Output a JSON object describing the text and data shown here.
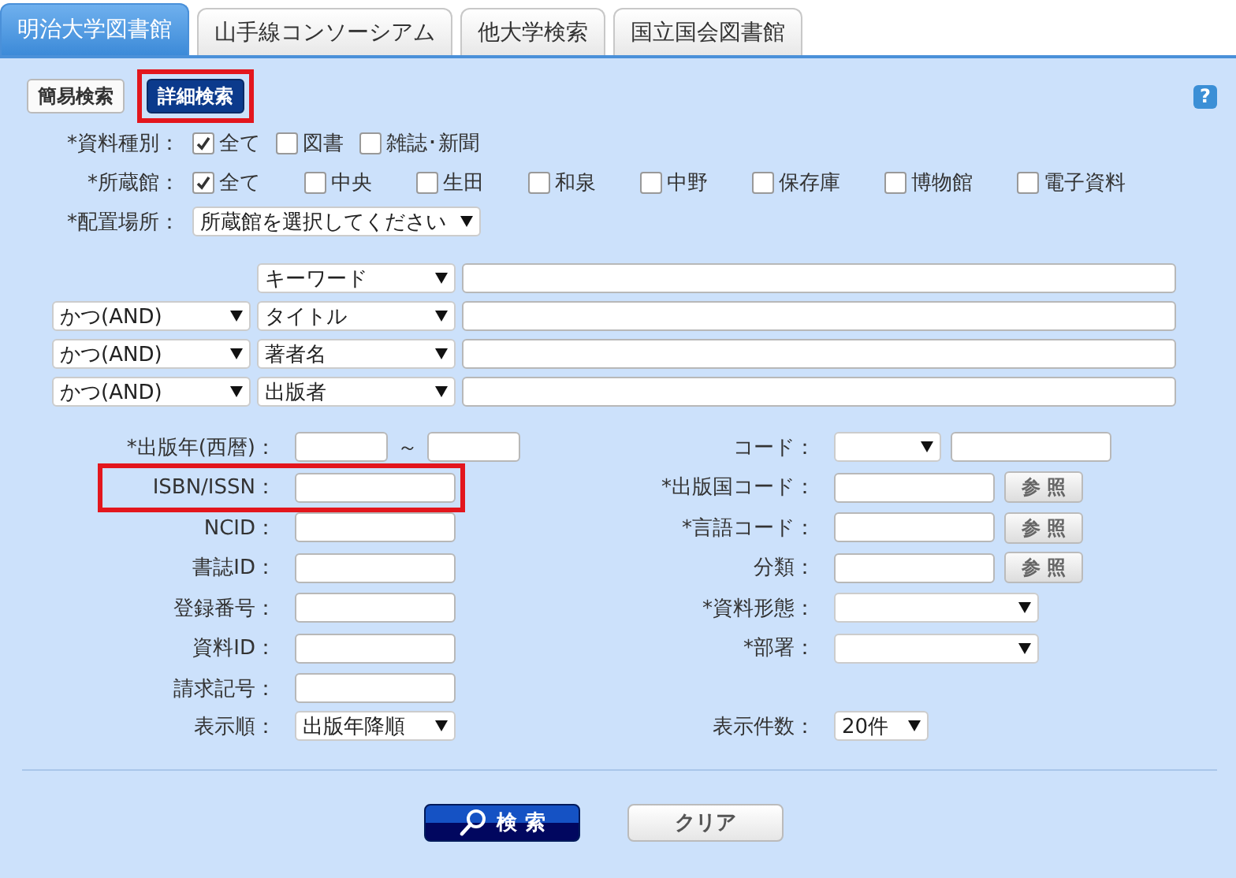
{
  "tabs": [
    {
      "label": "明治大学図書館",
      "selected": true
    },
    {
      "label": "山手線コンソーシアム",
      "selected": false
    },
    {
      "label": "他大学検索",
      "selected": false
    },
    {
      "label": "国立国会図書館",
      "selected": false
    }
  ],
  "mode_buttons": [
    {
      "label": "簡易検索",
      "selected": false,
      "highlighted": false
    },
    {
      "label": "詳細検索",
      "selected": true,
      "highlighted": true
    }
  ],
  "help": {
    "label": "?"
  },
  "filters": [
    {
      "label": "*資料種別：",
      "kind": "compact",
      "options": [
        {
          "label": "全て",
          "checked": true
        },
        {
          "label": "図書",
          "checked": false
        },
        {
          "label": "雑誌･新聞",
          "checked": false
        }
      ]
    },
    {
      "label": "*所蔵館：",
      "kind": "spread",
      "options": [
        {
          "label": "全て",
          "checked": true
        },
        {
          "label": "中央",
          "checked": false
        },
        {
          "label": "生田",
          "checked": false
        },
        {
          "label": "和泉",
          "checked": false
        },
        {
          "label": "中野",
          "checked": false
        },
        {
          "label": "保存庫",
          "checked": false
        },
        {
          "label": "博物館",
          "checked": false
        },
        {
          "label": "電子資料",
          "checked": false
        }
      ]
    },
    {
      "label": "*配置場所：",
      "kind": "select",
      "value": "所蔵館を選択してください"
    }
  ],
  "keyword_rows": [
    {
      "field": "キーワード"
    },
    {
      "operator": "かつ(AND)",
      "field": "タイトル"
    },
    {
      "operator": "かつ(AND)",
      "field": "著者名"
    },
    {
      "operator": "かつ(AND)",
      "field": "出版者"
    }
  ],
  "left_fields": [
    {
      "label": "*出版年(西暦)：",
      "kind": "range",
      "separator": "～",
      "highlighted": false
    },
    {
      "label": "ISBN/ISSN：",
      "kind": "text",
      "highlighted": true
    },
    {
      "label": "NCID：",
      "kind": "text",
      "highlighted": false
    },
    {
      "label": "書誌ID：",
      "kind": "text",
      "highlighted": false
    },
    {
      "label": "登録番号：",
      "kind": "text",
      "highlighted": false
    },
    {
      "label": "資料ID：",
      "kind": "text",
      "highlighted": false
    },
    {
      "label": "請求記号：",
      "kind": "text",
      "highlighted": false
    }
  ],
  "right_fields": [
    {
      "label": "コード：",
      "kind": "select-text"
    },
    {
      "label": "*出版国コード：",
      "kind": "lookup",
      "button": "参 照"
    },
    {
      "label": "*言語コード：",
      "kind": "lookup",
      "button": "参 照"
    },
    {
      "label": "分類：",
      "kind": "lookup",
      "button": "参 照"
    },
    {
      "label": "*資料形態：",
      "kind": "select"
    },
    {
      "label": "*部署：",
      "kind": "select"
    }
  ],
  "display_options": [
    {
      "label": "表示順：",
      "value": "出版年降順",
      "kind": "wide"
    },
    {
      "label": "表示件数：",
      "value": "20件",
      "kind": "narrow"
    }
  ],
  "actions": [
    {
      "label": "検 索",
      "kind": "primary"
    },
    {
      "label": "クリア",
      "kind": "secondary"
    }
  ]
}
